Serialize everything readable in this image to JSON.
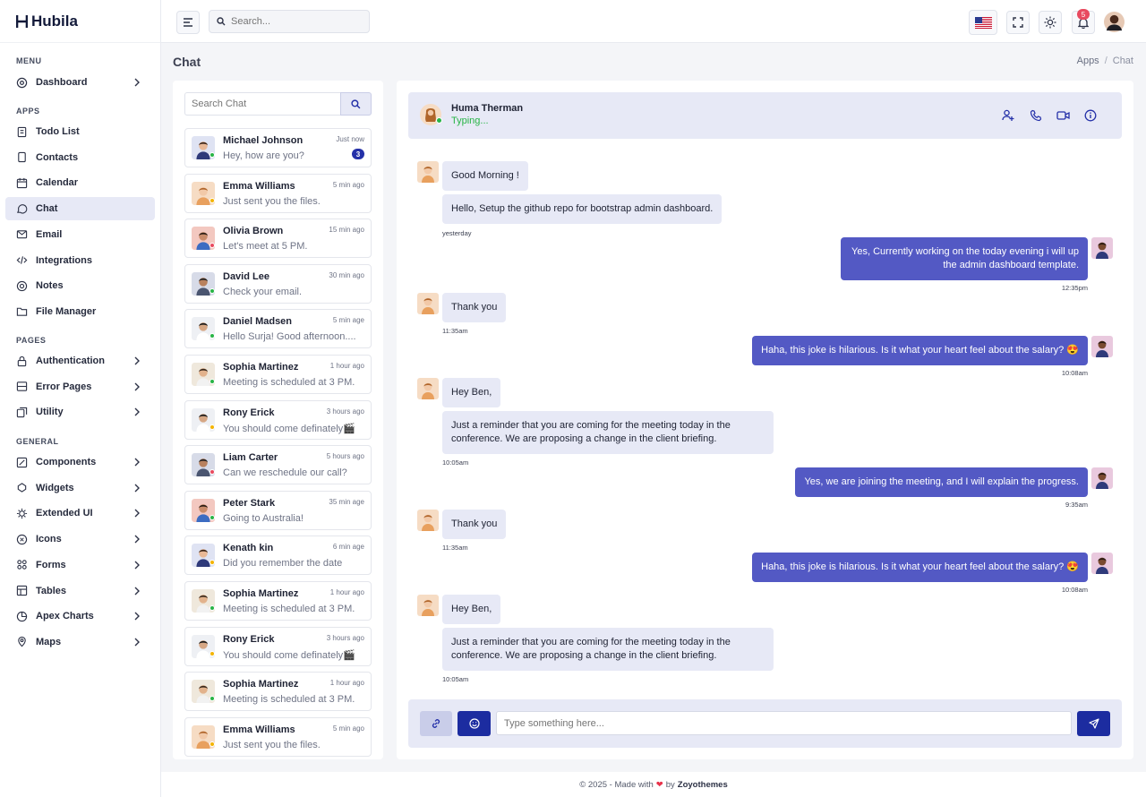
{
  "app": {
    "brand": "Hubila"
  },
  "colors": {
    "accent": "#2430a8",
    "bubble_out": "#5359c4",
    "bubble_in": "#e7e9f6",
    "online": "#28b446",
    "away": "#f4b400",
    "busy": "#e84a5f"
  },
  "sidebar": {
    "menu_heading": "MENU",
    "apps_heading": "APPS",
    "pages_heading": "PAGES",
    "general_heading": "GENERAL",
    "dashboard": "Dashboard",
    "apps": [
      "Todo List",
      "Contacts",
      "Calendar",
      "Chat",
      "Email",
      "Integrations",
      "Notes",
      "File Manager"
    ],
    "pages": [
      "Authentication",
      "Error Pages",
      "Utility"
    ],
    "general": [
      "Components",
      "Widgets",
      "Extended UI",
      "Icons",
      "Forms",
      "Tables",
      "Apex Charts",
      "Maps"
    ]
  },
  "topbar": {
    "search_placeholder": "Search...",
    "notification_count": "5"
  },
  "page": {
    "title": "Chat",
    "breadcrumb": [
      "Apps",
      "Chat"
    ],
    "breadcrumb_sep": "/"
  },
  "chat_list": {
    "search_placeholder": "Search Chat",
    "contacts": [
      {
        "name": "Michael Johnson",
        "message": "Hey, how are you?",
        "time": "Just now",
        "badge": "3",
        "status": "online"
      },
      {
        "name": "Emma Williams",
        "message": "Just sent you the files.",
        "time": "5 min ago",
        "status": "away"
      },
      {
        "name": "Olivia Brown",
        "message": "Let's meet at 5 PM.",
        "time": "15 min ago",
        "status": "busy"
      },
      {
        "name": "David Lee",
        "message": "Check your email.",
        "time": "30 min ago",
        "status": "online"
      },
      {
        "name": "Daniel Madsen",
        "message": "Hello Surja! Good afternoon....",
        "time": "5 min age",
        "status": "online"
      },
      {
        "name": "Sophia Martinez",
        "message": "Meeting is scheduled at 3 PM.",
        "time": "1 hour ago",
        "status": "online"
      },
      {
        "name": "Rony Erick",
        "message": "You should come definately🎬",
        "time": "3 hours ago",
        "status": "away"
      },
      {
        "name": "Liam Carter",
        "message": "Can we reschedule our call?",
        "time": "5 hours ago",
        "status": "busy"
      },
      {
        "name": "Peter Stark",
        "message": "Going to Australia!",
        "time": "35 min age",
        "status": "online"
      },
      {
        "name": "Kenath kin",
        "message": "Did you remember the date",
        "time": "6 min age",
        "status": "away"
      },
      {
        "name": "Sophia Martinez",
        "message": "Meeting is scheduled at 3 PM.",
        "time": "1 hour ago",
        "status": "online"
      },
      {
        "name": "Rony Erick",
        "message": "You should come definately🎬",
        "time": "3 hours ago",
        "status": "away"
      },
      {
        "name": "Sophia Martinez",
        "message": "Meeting is scheduled at 3 PM.",
        "time": "1 hour ago",
        "status": "online"
      },
      {
        "name": "Emma Williams",
        "message": "Just sent you the files.",
        "time": "5 min ago",
        "status": "away"
      }
    ]
  },
  "conversation": {
    "contact_name": "Huma Therman",
    "contact_status": "Typing...",
    "messages": [
      {
        "dir": "in",
        "text": "Good Morning !"
      },
      {
        "dir": "in",
        "text": "Hello, Setup the github repo for bootstrap admin dashboard."
      },
      {
        "dir": "time",
        "text": "yesterday"
      },
      {
        "dir": "out",
        "text": "Yes, Currently working on the today evening i will up the admin dashboard template."
      },
      {
        "dir": "time",
        "text": "12:35pm"
      },
      {
        "dir": "in",
        "text": "Thank you"
      },
      {
        "dir": "time",
        "text": "11:35am"
      },
      {
        "dir": "out",
        "text": "Haha, this joke is hilarious. Is it what your heart feel about the salary? 😍"
      },
      {
        "dir": "time",
        "text": "10:08am"
      },
      {
        "dir": "in",
        "text": "Hey Ben,"
      },
      {
        "dir": "in",
        "text": "Just a reminder that you are coming for the meeting today in the conference. We are proposing a change in the client briefing."
      },
      {
        "dir": "time",
        "text": "10:05am"
      },
      {
        "dir": "out",
        "text": "Yes, we are joining the meeting, and I will explain the progress."
      },
      {
        "dir": "time",
        "text": "9:35am"
      },
      {
        "dir": "in",
        "text": "Thank you"
      },
      {
        "dir": "time",
        "text": "11:35am"
      },
      {
        "dir": "out",
        "text": "Haha, this joke is hilarious. Is it what your heart feel about the salary? 😍"
      },
      {
        "dir": "time",
        "text": "10:08am"
      },
      {
        "dir": "in",
        "text": "Hey Ben,"
      },
      {
        "dir": "in",
        "text": "Just a reminder that you are coming for the meeting today in the conference. We are proposing a change in the client briefing."
      },
      {
        "dir": "time",
        "text": "10:05am"
      }
    ],
    "composer_placeholder": "Type something here..."
  },
  "footer": {
    "prefix": "© 2025 - Made with",
    "heart": "❤",
    "by": "by",
    "author": "Zoyothemes"
  }
}
